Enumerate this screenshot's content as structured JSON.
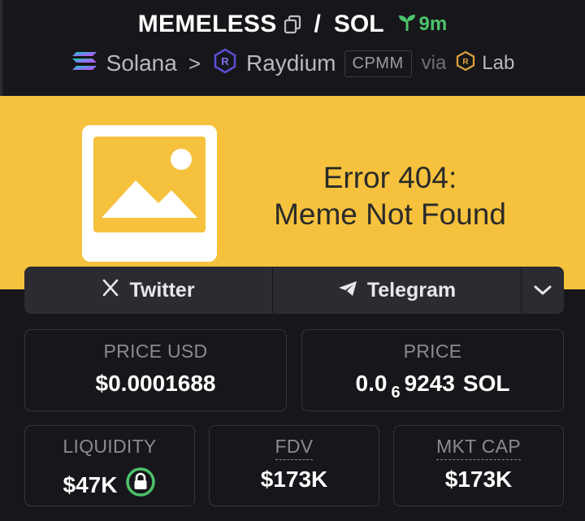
{
  "header": {
    "token_symbol": "MEMELESS",
    "separator": "/",
    "quote_symbol": "SOL",
    "age": "9m",
    "chain": "Solana",
    "dex": "Raydium",
    "pool_type": "CPMM",
    "via_label": "via",
    "launchpad": "Lab"
  },
  "banner": {
    "error_line1": "Error 404:",
    "error_line2": "Meme Not Found"
  },
  "socials": {
    "twitter_label": "Twitter",
    "telegram_label": "Telegram"
  },
  "stats": {
    "price_usd_label": "PRICE USD",
    "price_usd_value": "$0.0001688",
    "price_label": "PRICE",
    "price_prefix": "0.0",
    "price_subscript": "6",
    "price_digits": "9243",
    "price_unit": "SOL",
    "liquidity_label": "LIQUIDITY",
    "liquidity_value": "$47K",
    "fdv_label": "FDV",
    "fdv_value": "$173K",
    "mktcap_label": "MKT CAP",
    "mktcap_value": "$173K"
  },
  "colors": {
    "background": "#17171b",
    "banner": "#f6c23d",
    "age_green": "#4cc46a",
    "lock_green": "#4cc46a",
    "raydium_purple": "#5a4fd6"
  },
  "icons": [
    "copy-icon",
    "sprout-icon",
    "solana-logo-icon",
    "raydium-logo-icon",
    "lab-logo-icon",
    "image-placeholder-icon",
    "x-logo-icon",
    "telegram-plane-icon",
    "chevron-down-icon",
    "lock-icon"
  ]
}
